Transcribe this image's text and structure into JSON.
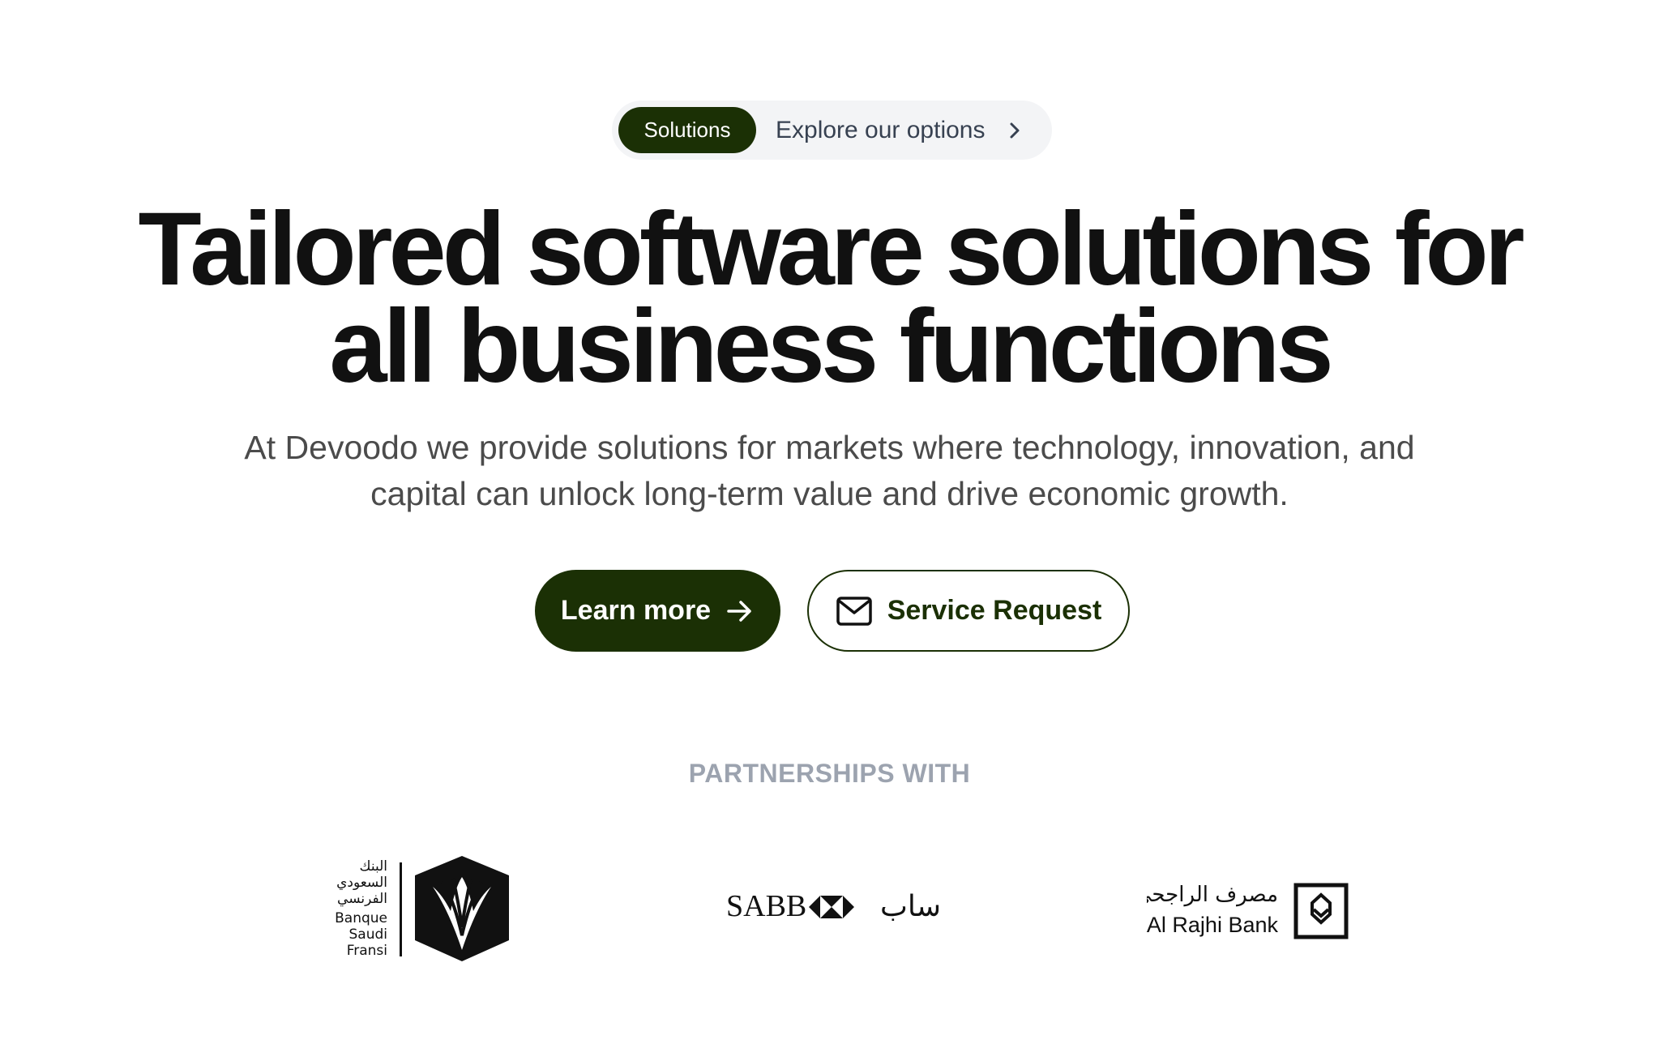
{
  "announcement": {
    "badge": "Solutions",
    "text": "Explore our options",
    "icon": "chevron-right-icon"
  },
  "hero": {
    "title_line1": "Tailored software solutions for",
    "title_line2": "all business functions",
    "subtitle": "At Devoodo we provide solutions for markets where technology, innovation, and capital can unlock long-term value and drive economic growth."
  },
  "actions": {
    "primary_label": "Learn more",
    "primary_icon": "arrow-right-icon",
    "secondary_label": "Service Request",
    "secondary_icon": "mail-icon"
  },
  "partners": {
    "heading": "PARTNERSHIPS WITH",
    "logos": [
      {
        "name": "Banque Saudi Fransi",
        "text_ar": "البنك السعودي الفرنسي",
        "text_en": [
          "Banque",
          "Saudi",
          "Fransi"
        ]
      },
      {
        "name": "SABB",
        "text_en": "SABB",
        "text_ar": "ساب"
      },
      {
        "name": "Al Rajhi Bank",
        "text_ar": "مصرف الراجحي",
        "text_en": "Al Rajhi Bank"
      }
    ]
  },
  "colors": {
    "brand": "#1b3005",
    "heading": "#111111",
    "muted": "#9ca3af",
    "pill_bg": "#f3f4f6"
  }
}
